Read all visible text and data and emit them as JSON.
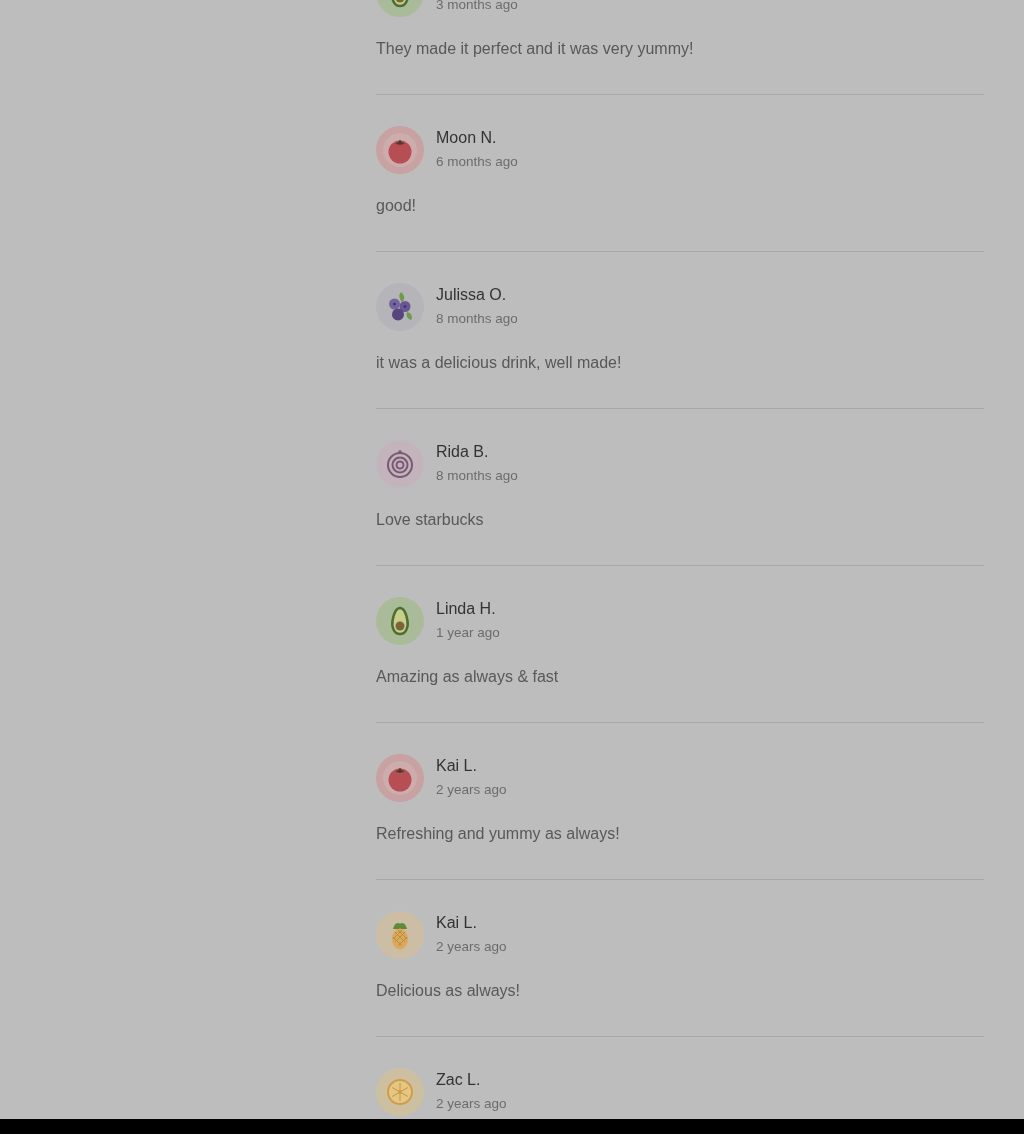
{
  "reviews": [
    {
      "kind": "avocado",
      "time": "3 months ago",
      "comment": "They made it perfect and it was very yummy!"
    },
    {
      "kind": "tomato",
      "name": "Moon N.",
      "time": "6 months ago",
      "comment": "good!"
    },
    {
      "kind": "blueberries",
      "name": "Julissa O.",
      "time": "8 months ago",
      "comment": "it was a delicious drink, well made!"
    },
    {
      "kind": "onion",
      "name": "Rida B.",
      "time": "8 months ago",
      "comment": "Love starbucks"
    },
    {
      "kind": "avocado",
      "name": "Linda H.",
      "time": "1 year ago",
      "comment": "Amazing as always & fast"
    },
    {
      "kind": "tomato",
      "name": "Kai L.",
      "time": "2 years ago",
      "comment": "Refreshing and yummy as always!"
    },
    {
      "kind": "pineapple",
      "name": "Kai L.",
      "time": "2 years ago",
      "comment": "Delicious as always!"
    },
    {
      "kind": "citrus",
      "name": "Zac L.",
      "time": "2 years ago"
    }
  ]
}
